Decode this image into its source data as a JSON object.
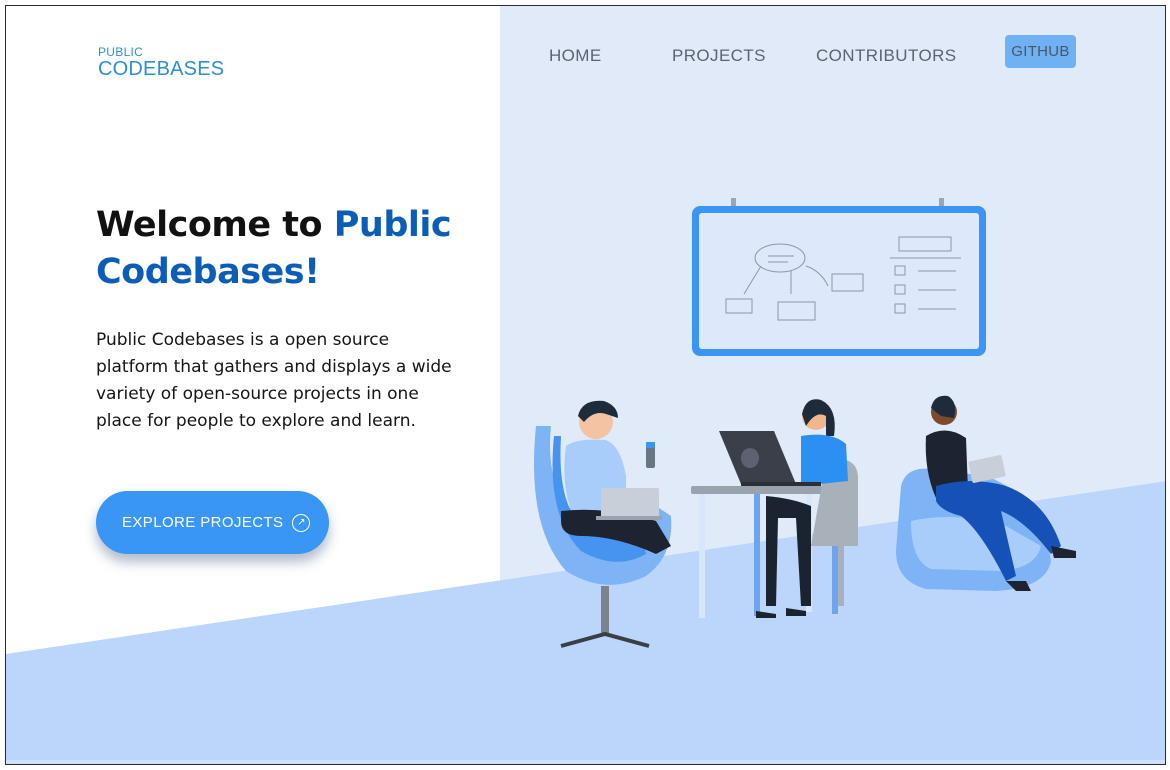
{
  "logo": {
    "line1": "PUBLIC",
    "line2": "CODEBASES"
  },
  "nav": {
    "home": "HOME",
    "projects": "PROJECTS",
    "contributors": "CONTRIBUTORS",
    "github": "GITHUB"
  },
  "hero": {
    "title_prefix": "Welcome to ",
    "title_accent": "Public Codebases!",
    "description": "Public Codebases is a open source platform that gathers and displays a wide variety of open-source projects in one place for people to explore and learn.",
    "cta_label": "EXPLORE PROJECTS",
    "cta_icon": "arrow-up-right-circle-icon"
  },
  "colors": {
    "brand_blue": "#2c8fd6",
    "accent_dark_blue": "#0c5db8",
    "button_blue": "#3996f4",
    "panel_bg": "#e1eaf9",
    "floor_blue": "#bcd5fb"
  },
  "illustration": {
    "name": "team-collaboration-illustration"
  }
}
